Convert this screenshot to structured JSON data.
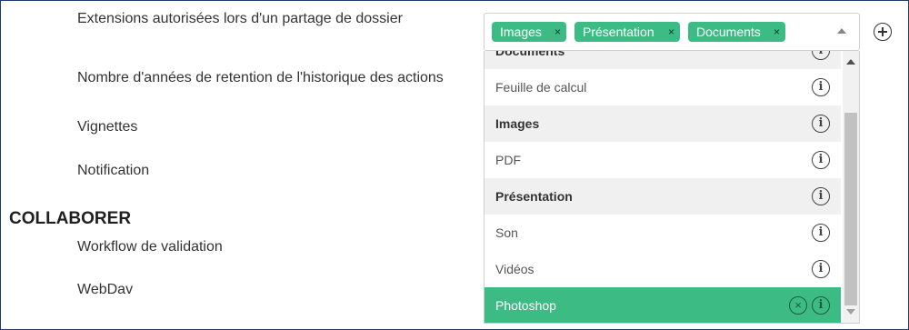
{
  "settings": {
    "labels": [
      "Extensions autorisées lors d'un partage de dossier",
      "Nombre d'années de retention de l'historique des actions",
      "Vignettes",
      "Notification",
      "Workflow de validation",
      "WebDav"
    ],
    "section_title": "COLLABORER"
  },
  "multiselect": {
    "chips": [
      {
        "label": "Images",
        "remove": "×"
      },
      {
        "label": "Présentation",
        "remove": "×"
      },
      {
        "label": "Documents",
        "remove": "×"
      }
    ],
    "add_icon": "plus-circle-icon",
    "caret_icon": "caret-up-icon"
  },
  "dropdown": {
    "options": [
      {
        "label": "Documents",
        "type": "group"
      },
      {
        "label": "Feuille de calcul",
        "type": "item"
      },
      {
        "label": "Images",
        "type": "group"
      },
      {
        "label": "PDF",
        "type": "item"
      },
      {
        "label": "Présentation",
        "type": "group"
      },
      {
        "label": "Son",
        "type": "item"
      },
      {
        "label": "Vidéos",
        "type": "item"
      },
      {
        "label": "Photoshop",
        "type": "selected"
      }
    ],
    "info_glyph": "i",
    "clear_glyph": "×",
    "highlight_color": "#3dbb84"
  }
}
